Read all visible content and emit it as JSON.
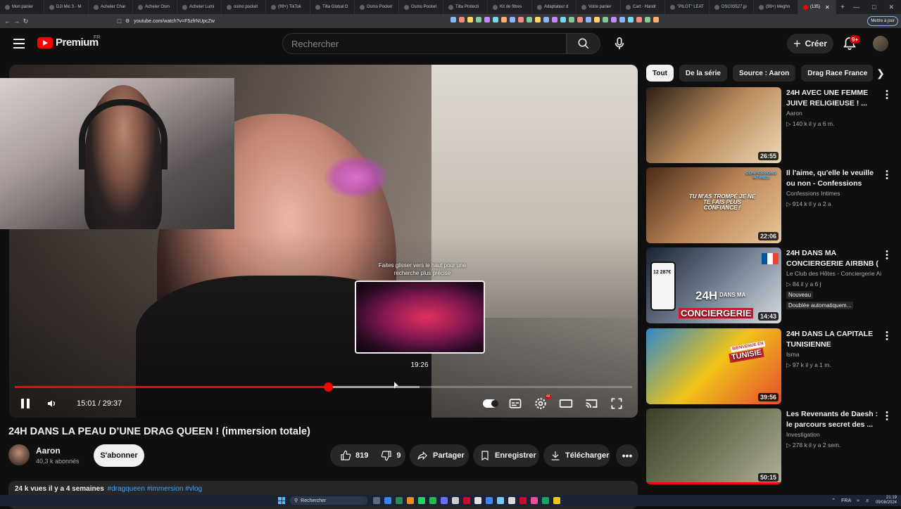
{
  "browser": {
    "tabs": [
      {
        "label": "Mon panier"
      },
      {
        "label": "DJI Mic 3 - M"
      },
      {
        "label": "Acheter Char"
      },
      {
        "label": "Acheter Osm"
      },
      {
        "label": "Acheter Lumi"
      },
      {
        "label": "osmo pocket"
      },
      {
        "label": "(99+) TikTok"
      },
      {
        "label": "Tilta Global O"
      },
      {
        "label": "Osmo Pocket"
      },
      {
        "label": "Osmo Pocket"
      },
      {
        "label": "Tilta Protecti"
      },
      {
        "label": "Kit de filtres"
      },
      {
        "label": "Adaptateur d"
      },
      {
        "label": "Votre panier"
      },
      {
        "label": "Cart - Handr"
      },
      {
        "label": "\"PILOT\" LEAT"
      },
      {
        "label": "DSC03527.jp"
      },
      {
        "label": "(99+) Meghn"
      }
    ],
    "active_tab": {
      "label": "(135)"
    },
    "url": "youtube.com/watch?v=F5zfrNUpcZw",
    "update_button": "Mettre à jour"
  },
  "header": {
    "logo_text": "Premium",
    "logo_region": "FR",
    "search_placeholder": "Rechercher",
    "create_label": "Créer",
    "notif_badge": "9+"
  },
  "player": {
    "current_time": "15:01",
    "duration": "29:37",
    "time_display": "15:01 / 29:37",
    "progress_fraction": 0.507,
    "buffer_fraction": 0.656,
    "seek_hint": "Faites glisser vers le haut pour une recherche plus précise",
    "preview_time": "19:26"
  },
  "video": {
    "title": "24H DANS LA PEAU D’UNE DRAG QUEEN ! (immersion totale)",
    "channel": "Aaron",
    "subscribers": "40,3 k abonnés",
    "subscribe_label": "S'abonner",
    "likes": "819",
    "dislikes": "9",
    "share_label": "Partager",
    "save_label": "Enregistrer",
    "download_label": "Télécharger",
    "views_date": "24 k vues  il y a 4 semaines",
    "hashtags": "#dragqueen #immersion #vlog"
  },
  "chips": [
    "Tout",
    "De la série",
    "Source : Aaron",
    "Drag Race France"
  ],
  "recommendations": [
    {
      "title": "24H AVEC UNE FEMME JUIVE RELIGIEUSE ! ...",
      "channel": "Aaron",
      "meta": "140 k  il y a 6 m.",
      "duration": "26:55",
      "colors": [
        "#2b1e17",
        "#b7895b",
        "#f0d9b5"
      ]
    },
    {
      "title": "Il l'aime, qu'elle le veuille ou non - Confessions Intimes",
      "channel": "Confessions Intimes",
      "meta": "914 k  il y a 2 a",
      "duration": "22:06",
      "colors": [
        "#4a2a16",
        "#b98457",
        "#e9c79a"
      ],
      "overlay_text": "TU M'AS TROMPÉ JE NE TE FAIS PLUS CONFIANCE !",
      "overlay_brand": "CONFESSIONS INTIMES"
    },
    {
      "title": "24H DANS MA CONCIERGERIE AIRBNB ( ...",
      "channel": "Le Club des Hôtes - Conciergerie Air...",
      "meta": "84  il y a 6 j",
      "duration": "14:43",
      "badge_new": "Nouveau",
      "badge_dub": "Doublée automatiquem...",
      "colors": [
        "#1a2230",
        "#6f7c8d",
        "#d7dbe3"
      ],
      "overlay_text": "24H",
      "overlay_sub": "DANS MA",
      "overlay_big": "CONCIERGERIE",
      "overlay_phone": "12 287€"
    },
    {
      "title": "24H DANS LA CAPITALE TUNISIENNE",
      "channel": "Isma",
      "meta": "97 k  il y a 1 m.",
      "duration": "39:56",
      "colors": [
        "#2f87c8",
        "#f0c419",
        "#e44c2c"
      ],
      "overlay_text": "BIENVENUE EN",
      "overlay_big": "TUNISIE"
    },
    {
      "title": "Les Revenants de Daesh : le parcours secret des ...",
      "channel": "Investigation",
      "meta": "278 k  il y a 2 sem.",
      "duration": "50:15",
      "watched_fraction": 1.0,
      "colors": [
        "#3a3f2c",
        "#6f7455",
        "#b2b09a"
      ]
    }
  ],
  "taskbar": {
    "search_label": "Rechercher",
    "lang": "FRA",
    "time": "21:19",
    "date": "09/08/2024"
  }
}
